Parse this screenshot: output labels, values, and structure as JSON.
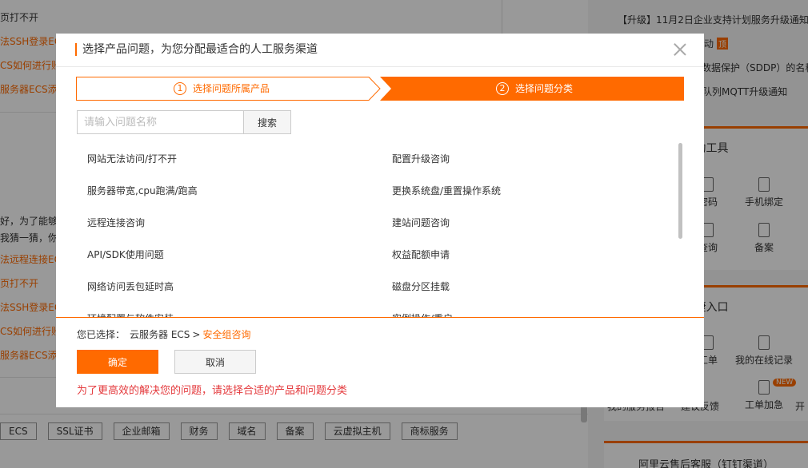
{
  "background": {
    "left_fragments": [
      {
        "text": "页打不开",
        "color": "gray"
      },
      {
        "text": "法SSH登录EC",
        "color": "orange"
      },
      {
        "text": "CS如何进行账",
        "color": "orange"
      },
      {
        "text": "服务器ECS添",
        "color": "orange"
      },
      {
        "text": "好，为了能够",
        "color": "gray"
      },
      {
        "text": "我猜一猜，你",
        "color": "gray"
      },
      {
        "text": "法远程连接EC",
        "color": "orange"
      },
      {
        "text": "页打不开",
        "color": "orange"
      },
      {
        "text": "法SSH登录EC",
        "color": "orange"
      },
      {
        "text": "CS如何进行账",
        "color": "orange"
      },
      {
        "text": "服务器ECS添",
        "color": "orange"
      }
    ],
    "tags": [
      "ECS",
      "SSL证书",
      "企业邮箱",
      "财务",
      "域名",
      "备案",
      "云虚拟主机",
      "商标服务"
    ],
    "notices": [
      {
        "text": "【升级】11月2日企业支持计划服务升级通知",
        "badge": ""
      },
      {
        "text": "动",
        "badge": "顶"
      },
      {
        "text": "数据保护（SDDP）的名称",
        "badge": ""
      },
      {
        "text": "队列MQTT升级通知",
        "badge": ""
      }
    ],
    "self_service": {
      "title": "自助工具",
      "tools": [
        "密码",
        "手机绑定",
        "查询",
        "备案"
      ]
    },
    "quick_entry": {
      "title": "快捷入口",
      "tools": [
        "工单",
        "我的在线记录",
        "我的服务报告",
        "建议反馈",
        "工单加急",
        "开"
      ],
      "new_badge": "NEW"
    },
    "bottom_right_text": "阿里云售后客服（钉钉渠道）"
  },
  "modal": {
    "title": "选择产品问题，为您分配最适合的人工服务渠道",
    "steps": [
      {
        "num": "1",
        "label": "选择问题所属产品",
        "state": "done"
      },
      {
        "num": "2",
        "label": "选择问题分类",
        "state": "active"
      }
    ],
    "search": {
      "placeholder": "请输入问题名称",
      "value": "",
      "button": "搜索"
    },
    "issues": [
      "网站无法访问/打不开",
      "配置升级咨询",
      "服务器带宽,cpu跑满/跑高",
      "更换系统盘/重置操作系统",
      "远程连接咨询",
      "建站问题咨询",
      "API/SDK使用问题",
      "权益配额申请",
      "网络访问丢包延时高",
      "磁盘分区挂载",
      "环境配置与软件安装",
      "实例操作/重启"
    ],
    "selected": {
      "label": "您已选择：",
      "product": "云服务器 ECS",
      "separator": ">",
      "category": "安全组咨询"
    },
    "ok_button": "确定",
    "cancel_button": "取消",
    "hint": "为了更高效的解决您的问题，请选择合适的产品和问题分类"
  },
  "colors": {
    "accent": "#ff6a00",
    "hint": "#e4393c"
  }
}
